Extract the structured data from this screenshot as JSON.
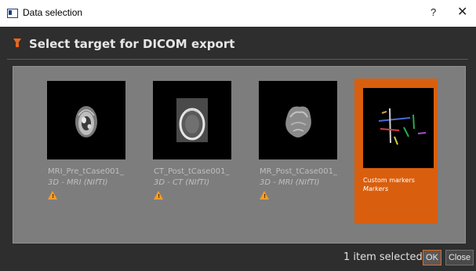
{
  "window": {
    "title": "Data selection",
    "help_label": "?",
    "close_label": "✕"
  },
  "header": {
    "title": "Select target for DICOM export",
    "icon": "funnel-icon",
    "accent_color": "#e8671e"
  },
  "items": [
    {
      "name": "MRI_Pre_tCase001_",
      "type": "3D - MRI (NIfTI)",
      "warning": true,
      "selected": false,
      "thumbnail": "axial-brain-mri"
    },
    {
      "name": "CT_Post_tCase001_",
      "type": "3D - CT (NIfTI)",
      "warning": true,
      "selected": false,
      "thumbnail": "axial-head-ct"
    },
    {
      "name": "MR_Post_tCase001_",
      "type": "3D - MRI (NIfTI)",
      "warning": true,
      "selected": false,
      "thumbnail": "brain-mri-render"
    },
    {
      "name": "Custom markers",
      "type": "Markers",
      "warning": false,
      "selected": true,
      "thumbnail": "colored-markers"
    }
  ],
  "footer": {
    "status": "1 item selected",
    "ok_label": "OK",
    "close_label": "Close"
  },
  "colors": {
    "selected_card": "#d95f0e",
    "warning": "#f29d2a",
    "grid_bg": "#7d7d7d",
    "panel_bg": "#2e2e2e"
  }
}
